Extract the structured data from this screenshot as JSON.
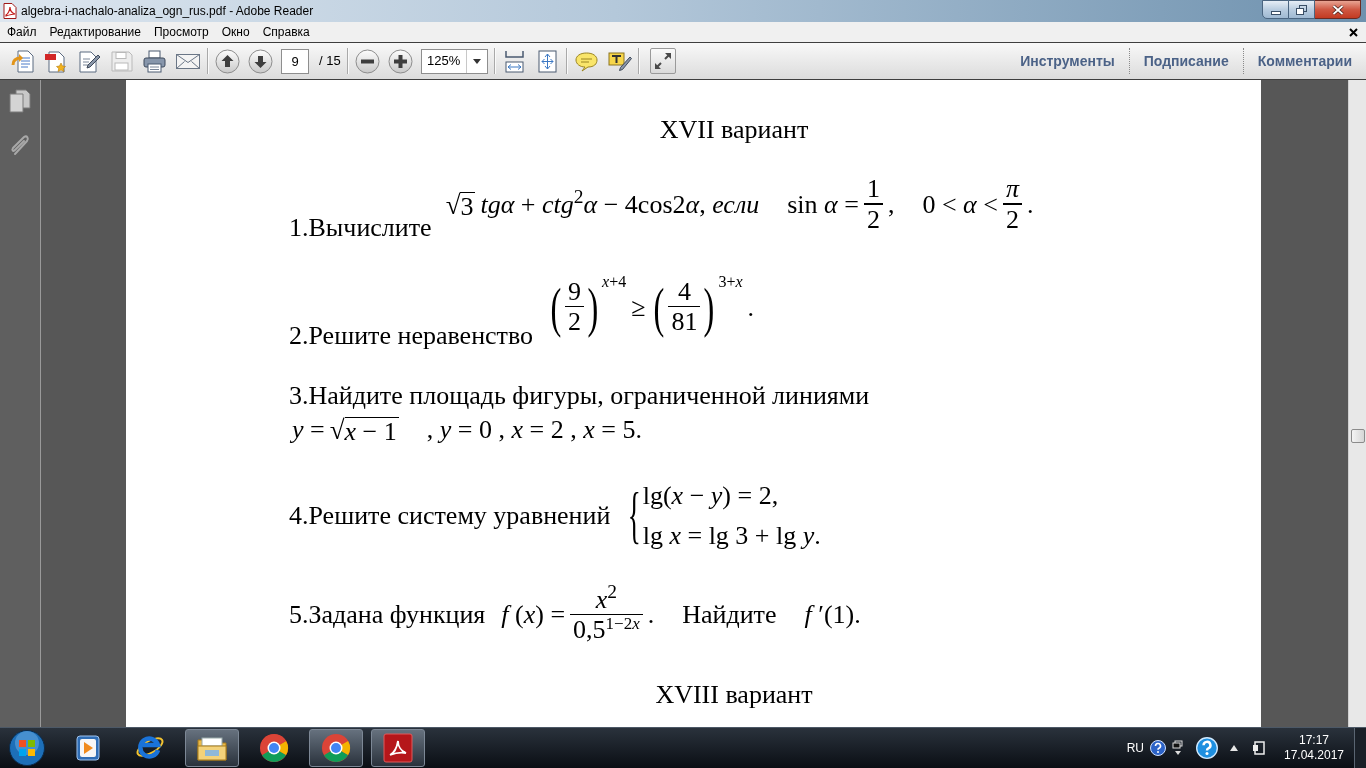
{
  "window": {
    "title": "algebra-i-nachalo-analiza_ogn_rus.pdf - Adobe Reader"
  },
  "menu": [
    "Файл",
    "Редактирование",
    "Просмотр",
    "Окно",
    "Справка"
  ],
  "toolbar": {
    "save": {
      "disabled": true
    },
    "page": {
      "value": "9",
      "total": "/ 15"
    },
    "zoom": {
      "value": "125%"
    },
    "panes": [
      "Инструменты",
      "Подписание",
      "Комментарии"
    ]
  },
  "document": {
    "blocks": [
      {
        "kind": "heading",
        "text": "XVII вариант"
      },
      {
        "kind": "aligned",
        "label": "1.Вычислите",
        "formula": [
          [
            {
              "kind": "root",
              "sign": "√",
              "radicand": "3"
            },
            {
              "kind": "run",
              "parts": [
                "*tgα* + *ctg*$^{2}$*α* − 4cos2",
                "*α*, *если*"
              ]
            }
          ],
          [
            {
              "kind": "text",
              "text": "sin *α* ="
            },
            {
              "kind": "frac",
              "num": "1",
              "den": "2"
            },
            {
              "kind": "text",
              "text": ","
            }
          ],
          [
            {
              "kind": "text",
              "text": "0 < *α* <"
            },
            {
              "kind": "frac",
              "num": "*π*",
              "den": "2"
            },
            {
              "kind": "text",
              "text": "."
            }
          ]
        ]
      },
      {
        "kind": "aligned",
        "label": "2.Решите неравенство",
        "formula": [
          [
            {
              "kind": "pfrac",
              "open": "(",
              "num": "9",
              "den": "2",
              "close": ")",
              "sup": "*x*+4"
            },
            {
              "kind": "text",
              "text": "≥"
            },
            {
              "kind": "pfrac",
              "open": "(",
              "num": "4",
              "den": "81",
              "close": ")",
              "sup": "3+*x*"
            },
            {
              "kind": "text",
              "text": "."
            }
          ]
        ]
      },
      {
        "kind": "stacked",
        "label": "3.Найдите площадь фигуры, ограниченной линиями",
        "formula": [
          [
            {
              "kind": "text",
              "text": "*y* ="
            },
            {
              "kind": "root",
              "sign": "√",
              "radicand": "*x* − 1"
            }
          ],
          [
            {
              "kind": "text",
              "text": ", *y* = 0 , *x* = 2 , *x* = 5."
            }
          ]
        ]
      },
      {
        "kind": "centered",
        "label": "4.Решите систему уравнений",
        "formula": [
          [
            {
              "kind": "system",
              "brace": "{",
              "lines": [
                "lg(*x* − *y*) = 2,",
                "lg *x* = lg 3 + lg *y*."
              ]
            }
          ]
        ]
      },
      {
        "kind": "centered",
        "label": "5.Задана функция",
        "formula": [
          [
            {
              "kind": "text",
              "text": "*f* (*x*) ="
            },
            {
              "kind": "frac",
              "num": "*x*$^{2}$",
              "den": "0,5",
              "den_exponent": [
                "1−2",
                "*x*"
              ]
            },
            {
              "kind": "text",
              "text": "."
            }
          ],
          [
            {
              "kind": "text",
              "text": "Найдите"
            }
          ],
          [
            {
              "kind": "text",
              "text": "*f* ′(1)."
            }
          ]
        ]
      },
      {
        "kind": "heading",
        "text": "XVIII вариант"
      }
    ]
  },
  "taskbar": {
    "apps": [
      {
        "running": false
      },
      {
        "running": false
      },
      {
        "running": true
      },
      {
        "running": false
      },
      {
        "running": true
      },
      {
        "running": true
      }
    ],
    "language": "RU",
    "time": "17:17",
    "date": "17.04.2017"
  }
}
